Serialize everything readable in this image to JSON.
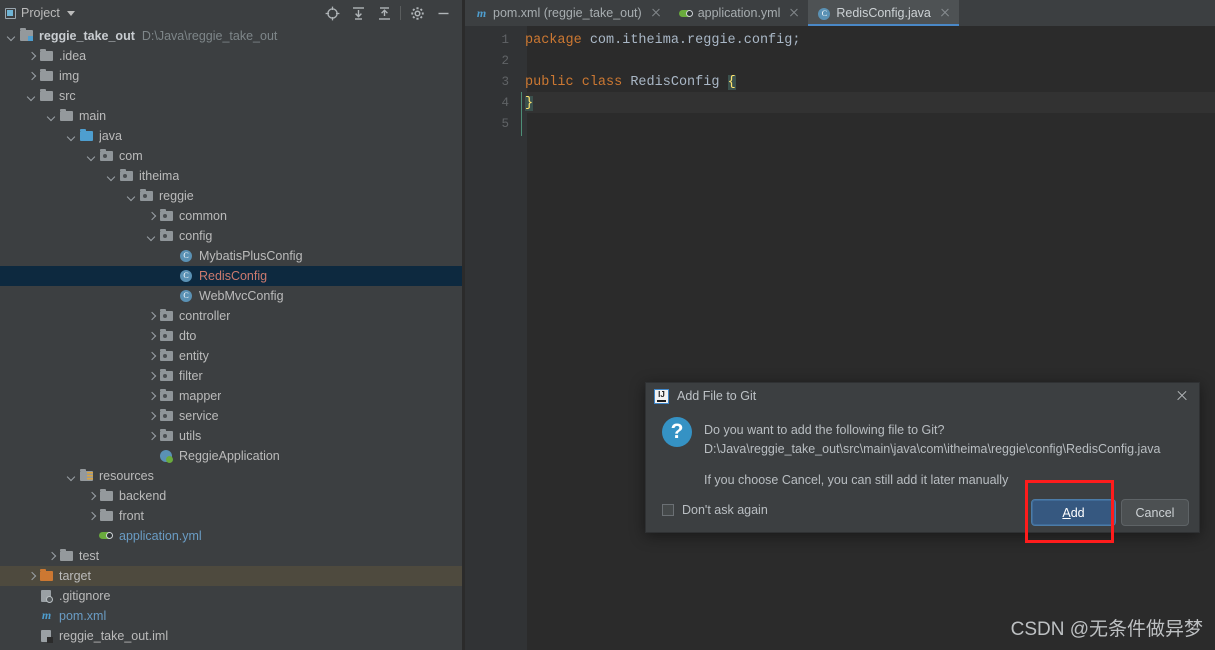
{
  "project_panel": {
    "title": "Project",
    "toolbar_icons": [
      {
        "name": "locate-icon",
        "glyph": "locate"
      },
      {
        "name": "expand-all-icon",
        "glyph": "expand-all"
      },
      {
        "name": "collapse-all-icon",
        "glyph": "collapse-all"
      },
      {
        "name": "settings-gear-icon",
        "glyph": "gear"
      },
      {
        "name": "hide-panel-icon",
        "glyph": "minus"
      }
    ],
    "tree": [
      {
        "label": "reggie_take_out",
        "sub": "D:\\Java\\reggie_take_out",
        "indent": 0,
        "arrow": "down",
        "icon": "module-folder",
        "style": "bold",
        "state": "normal"
      },
      {
        "label": ".idea",
        "sub": "",
        "indent": 1,
        "arrow": "right",
        "icon": "folder",
        "style": "",
        "state": "normal"
      },
      {
        "label": "img",
        "sub": "",
        "indent": 1,
        "arrow": "right",
        "icon": "folder",
        "style": "",
        "state": "normal"
      },
      {
        "label": "src",
        "sub": "",
        "indent": 1,
        "arrow": "down",
        "icon": "folder",
        "style": "",
        "state": "normal"
      },
      {
        "label": "main",
        "sub": "",
        "indent": 2,
        "arrow": "down",
        "icon": "folder",
        "style": "",
        "state": "normal"
      },
      {
        "label": "java",
        "sub": "",
        "indent": 3,
        "arrow": "down",
        "icon": "source-folder",
        "style": "",
        "state": "normal"
      },
      {
        "label": "com",
        "sub": "",
        "indent": 4,
        "arrow": "down",
        "icon": "package",
        "style": "",
        "state": "normal"
      },
      {
        "label": "itheima",
        "sub": "",
        "indent": 5,
        "arrow": "down",
        "icon": "package",
        "style": "",
        "state": "normal"
      },
      {
        "label": "reggie",
        "sub": "",
        "indent": 6,
        "arrow": "down",
        "icon": "package",
        "style": "",
        "state": "normal"
      },
      {
        "label": "common",
        "sub": "",
        "indent": 7,
        "arrow": "right",
        "icon": "package",
        "style": "",
        "state": "normal"
      },
      {
        "label": "config",
        "sub": "",
        "indent": 7,
        "arrow": "down",
        "icon": "package",
        "style": "",
        "state": "normal"
      },
      {
        "label": "MybatisPlusConfig",
        "sub": "",
        "indent": 8,
        "arrow": "none",
        "icon": "java-class",
        "style": "",
        "state": "normal"
      },
      {
        "label": "RedisConfig",
        "sub": "",
        "indent": 8,
        "arrow": "none",
        "icon": "java-class",
        "style": "red",
        "state": "selected"
      },
      {
        "label": "WebMvcConfig",
        "sub": "",
        "indent": 8,
        "arrow": "none",
        "icon": "java-class",
        "style": "",
        "state": "normal"
      },
      {
        "label": "controller",
        "sub": "",
        "indent": 7,
        "arrow": "right",
        "icon": "package",
        "style": "",
        "state": "normal"
      },
      {
        "label": "dto",
        "sub": "",
        "indent": 7,
        "arrow": "right",
        "icon": "package",
        "style": "",
        "state": "normal"
      },
      {
        "label": "entity",
        "sub": "",
        "indent": 7,
        "arrow": "right",
        "icon": "package",
        "style": "",
        "state": "normal"
      },
      {
        "label": "filter",
        "sub": "",
        "indent": 7,
        "arrow": "right",
        "icon": "package",
        "style": "",
        "state": "normal"
      },
      {
        "label": "mapper",
        "sub": "",
        "indent": 7,
        "arrow": "right",
        "icon": "package",
        "style": "",
        "state": "normal"
      },
      {
        "label": "service",
        "sub": "",
        "indent": 7,
        "arrow": "right",
        "icon": "package",
        "style": "",
        "state": "normal"
      },
      {
        "label": "utils",
        "sub": "",
        "indent": 7,
        "arrow": "right",
        "icon": "package",
        "style": "",
        "state": "normal"
      },
      {
        "label": "ReggieApplication",
        "sub": "",
        "indent": 7,
        "arrow": "none",
        "icon": "spring-class",
        "style": "",
        "state": "normal"
      },
      {
        "label": "resources",
        "sub": "",
        "indent": 3,
        "arrow": "down",
        "icon": "resources-folder",
        "style": "",
        "state": "normal"
      },
      {
        "label": "backend",
        "sub": "",
        "indent": 4,
        "arrow": "right",
        "icon": "folder",
        "style": "",
        "state": "normal"
      },
      {
        "label": "front",
        "sub": "",
        "indent": 4,
        "arrow": "right",
        "icon": "folder",
        "style": "",
        "state": "normal"
      },
      {
        "label": "application.yml",
        "sub": "",
        "indent": 4,
        "arrow": "none",
        "icon": "yaml-file",
        "style": "blue",
        "state": "normal"
      },
      {
        "label": "test",
        "sub": "",
        "indent": 2,
        "arrow": "right",
        "icon": "folder",
        "style": "",
        "state": "normal"
      },
      {
        "label": "target",
        "sub": "",
        "indent": 1,
        "arrow": "right",
        "icon": "target-folder",
        "style": "",
        "state": "hovered"
      },
      {
        "label": ".gitignore",
        "sub": "",
        "indent": 1,
        "arrow": "none",
        "icon": "gitignore-file",
        "style": "",
        "state": "normal"
      },
      {
        "label": "pom.xml",
        "sub": "",
        "indent": 1,
        "arrow": "none",
        "icon": "maven-file",
        "style": "blue",
        "state": "normal"
      },
      {
        "label": "reggie_take_out.iml",
        "sub": "",
        "indent": 1,
        "arrow": "none",
        "icon": "iml-file",
        "style": "",
        "state": "normal"
      }
    ]
  },
  "editor": {
    "tabs": [
      {
        "label": "pom.xml (reggie_take_out)",
        "icon": "maven-file",
        "active": false
      },
      {
        "label": "application.yml",
        "icon": "yaml-file",
        "active": false
      },
      {
        "label": "RedisConfig.java",
        "icon": "java-class",
        "active": true
      }
    ],
    "line_numbers": [
      "1",
      "2",
      "3",
      "4",
      "5"
    ],
    "code_lines": [
      {
        "num": "1",
        "tokens": [
          {
            "t": "package",
            "c": "kw"
          },
          {
            "t": " com.itheima.reggie.config;",
            "c": "pl"
          }
        ]
      },
      {
        "num": "2",
        "tokens": []
      },
      {
        "num": "3",
        "tokens": [
          {
            "t": "public",
            "c": "kw"
          },
          {
            "t": " ",
            "c": "pl"
          },
          {
            "t": "class",
            "c": "kw"
          },
          {
            "t": " RedisConfig ",
            "c": "pl"
          },
          {
            "t": "{",
            "c": "brc-hl"
          }
        ]
      },
      {
        "num": "4",
        "tokens": [
          {
            "t": "}",
            "c": "brc-hl"
          }
        ]
      },
      {
        "num": "5",
        "tokens": []
      }
    ]
  },
  "dialog": {
    "title": "Add File to Git",
    "icon": "intellij-idea-logo",
    "question_icon": "question-mark-icon",
    "message_line1": "Do you want to add the following file to Git?",
    "message_line2": "D:\\Java\\reggie_take_out\\src\\main\\java\\com\\itheima\\reggie\\config\\RedisConfig.java",
    "note": "If you choose Cancel, you can still add it later manually",
    "checkbox_label": "Don't ask again",
    "checkbox_checked": false,
    "add_button": {
      "mnemonic": "A",
      "rest": "dd",
      "full": "Add"
    },
    "cancel_button": "Cancel",
    "close_icon": "close-icon"
  },
  "annotation": {
    "highlight_color": "#ff1c1c",
    "target": "add-button"
  },
  "watermark": "CSDN @无条件做异梦",
  "colors": {
    "panel_bg": "#3c3f41",
    "editor_bg": "#2b2b2b",
    "selection_bg": "#0d293f",
    "hover_bg": "#4e4a3e",
    "accent_blue": "#4a88c7",
    "keyword_orange": "#cc7832",
    "annotation_red": "#ff1c1c"
  }
}
